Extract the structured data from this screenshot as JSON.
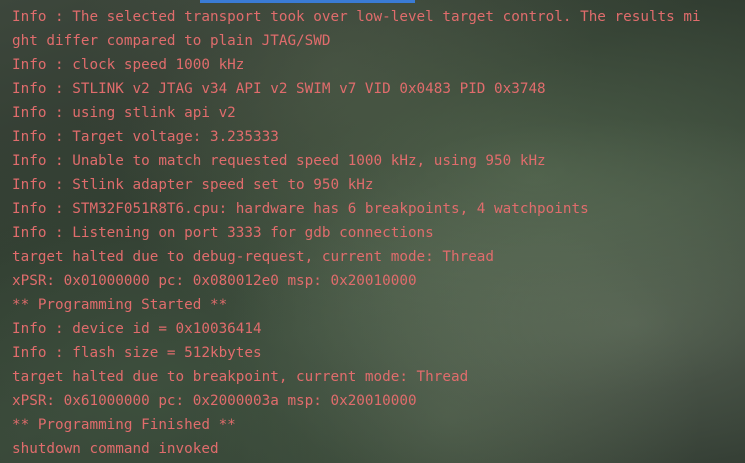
{
  "console": {
    "text_color": "#e06c6c",
    "lines": [
      "Info : The selected transport took over low-level target control. The results mi",
      "ght differ compared to plain JTAG/SWD",
      "Info : clock speed 1000 kHz",
      "Info : STLINK v2 JTAG v34 API v2 SWIM v7 VID 0x0483 PID 0x3748",
      "Info : using stlink api v2",
      "Info : Target voltage: 3.235333",
      "Info : Unable to match requested speed 1000 kHz, using 950 kHz",
      "Info : Stlink adapter speed set to 950 kHz",
      "Info : STM32F051R8T6.cpu: hardware has 6 breakpoints, 4 watchpoints",
      "Info : Listening on port 3333 for gdb connections",
      "target halted due to debug-request, current mode: Thread",
      "xPSR: 0x01000000 pc: 0x080012e0 msp: 0x20010000",
      "** Programming Started **",
      "Info : device id = 0x10036414",
      "Info : flash size = 512kbytes",
      "target halted due to breakpoint, current mode: Thread",
      "xPSR: 0x61000000 pc: 0x2000003a msp: 0x20010000",
      "** Programming Finished **",
      "shutdown command invoked"
    ]
  }
}
